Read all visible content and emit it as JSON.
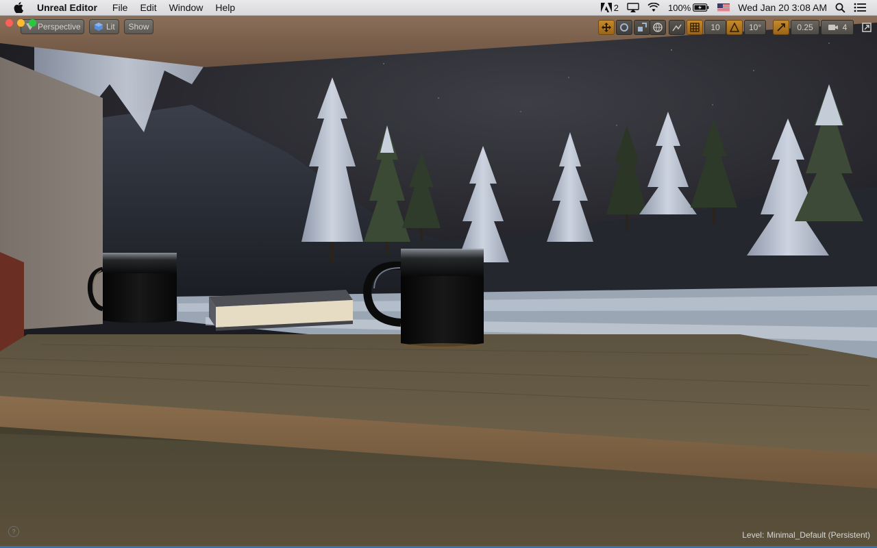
{
  "menubar": {
    "app_name": "Unreal Editor",
    "menus": [
      "File",
      "Edit",
      "Window",
      "Help"
    ],
    "adobe_badge": "2",
    "battery_percent": "100%",
    "datetime": "Wed Jan 20  3:08 AM"
  },
  "viewport": {
    "perspective_label": "Perspective",
    "lit_label": "Lit",
    "show_label": "Show",
    "grid_snap_value": "10",
    "rotation_snap_value": "10°",
    "scale_snap_value": "0.25",
    "camera_speed_value": "4",
    "level_prefix": "Level:",
    "level_name": "Minimal_Default (Persistent)"
  },
  "colors": {
    "traffic_close": "#ff5f57",
    "traffic_minimize": "#febc2e",
    "traffic_zoom": "#28c840",
    "snap_orange": "#c58a2a"
  }
}
